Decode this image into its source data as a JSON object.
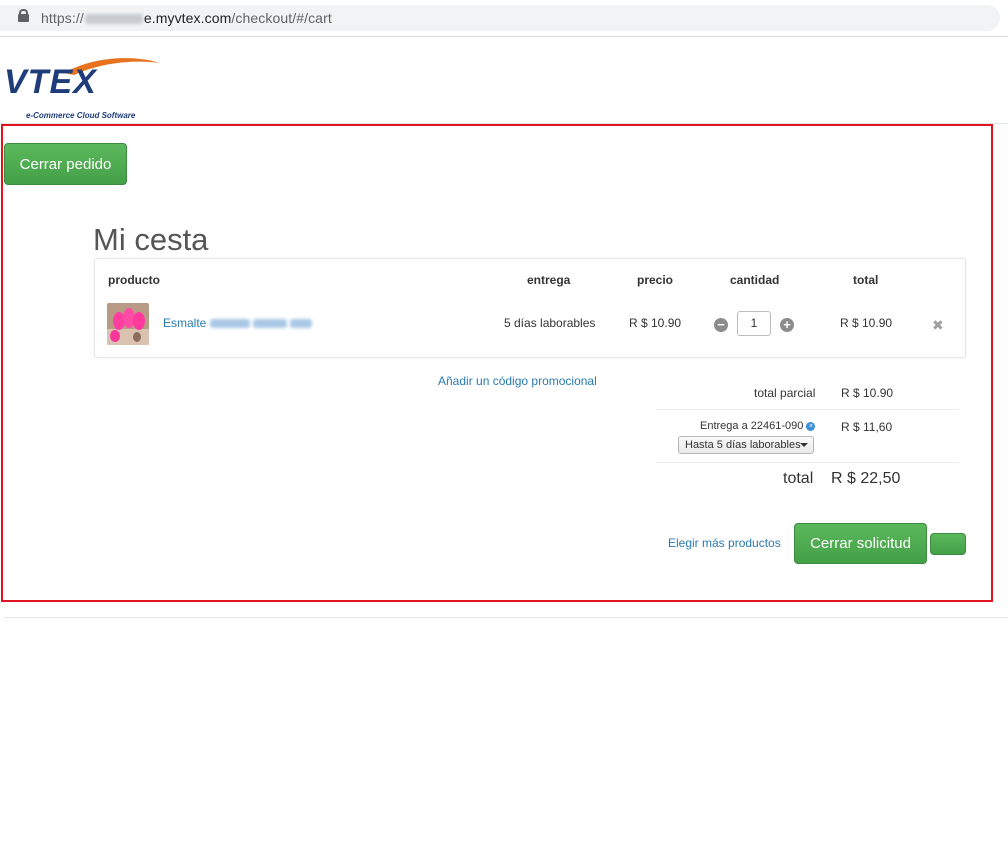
{
  "browser": {
    "url_prefix": "https://",
    "url_host_suffix": "e.myvtex.com",
    "url_path": "/checkout/#/cart"
  },
  "logo": {
    "text": "VTEX",
    "tagline": "e-Commerce Cloud Software"
  },
  "actions": {
    "cerrar_pedido": "Cerrar pedido",
    "cerrar_solicitud": "Cerrar solicitud",
    "elegir_mas": "Elegir más productos",
    "promo": "Añadir un código promocional"
  },
  "cart": {
    "title": "Mi cesta",
    "headers": {
      "producto": "producto",
      "entrega": "entrega",
      "precio": "precio",
      "cantidad": "cantidad",
      "total": "total"
    },
    "items": [
      {
        "name_prefix": "Esmalte",
        "entrega": "5 días laborables",
        "precio": "R $ 10.90",
        "cantidad": "1",
        "total": "R $ 10.90"
      }
    ]
  },
  "summary": {
    "subtotal_label": "total parcial",
    "subtotal_value": "R $ 10.90",
    "shipping_label": "Entrega a 22461-090",
    "shipping_value": "R $ 11,60",
    "shipping_option": "Hasta 5 días laborables",
    "total_label": "total",
    "total_value": "R $ 22,50"
  },
  "colors": {
    "accent_green": "#4cae4c",
    "link_blue": "#2a7ab0",
    "highlight_red": "#e0141e"
  }
}
